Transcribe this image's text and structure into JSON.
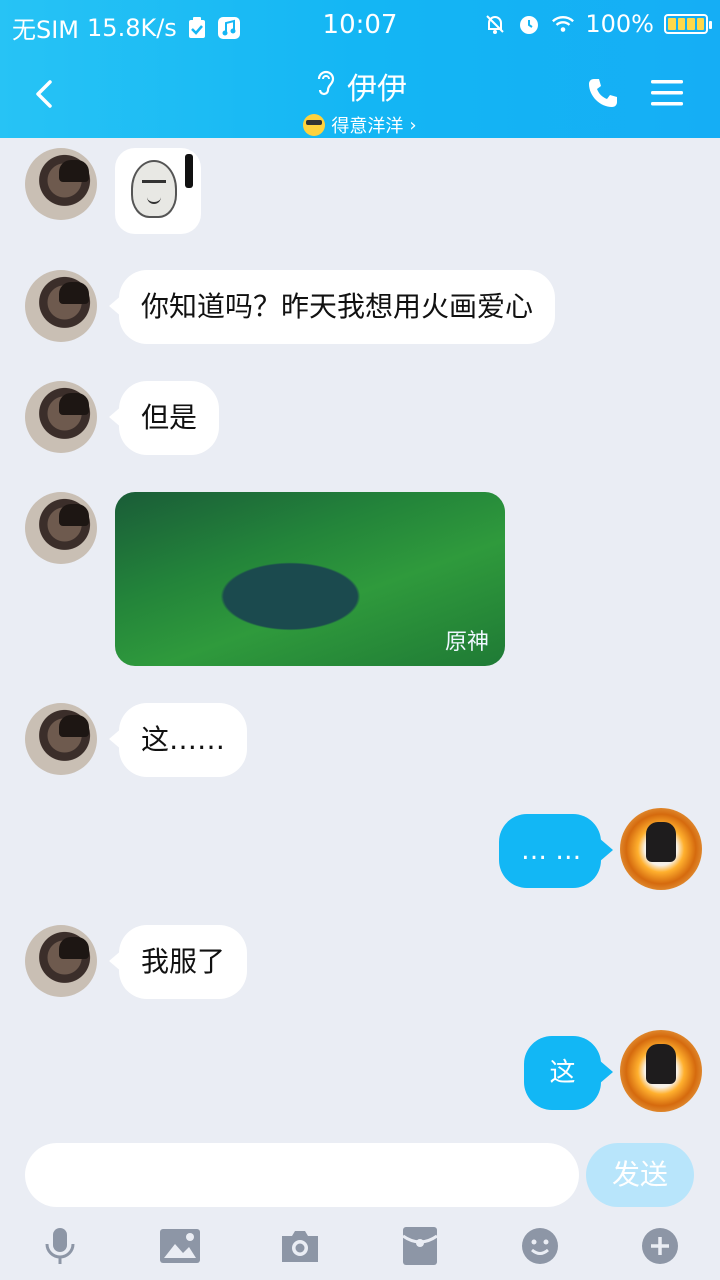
{
  "status_bar": {
    "carrier": "无SIM",
    "speed": "15.8K/s",
    "time": "10:07",
    "battery": "100%"
  },
  "header": {
    "title": "伊伊",
    "subtitle": "得意洋洋",
    "subtitle_chevron": "›"
  },
  "messages": [
    {
      "side": "left",
      "type": "sticker"
    },
    {
      "side": "left",
      "type": "text",
      "text": "你知道吗？昨天我想用火画爱心"
    },
    {
      "side": "left",
      "type": "text",
      "text": "但是"
    },
    {
      "side": "left",
      "type": "image",
      "watermark": "原神"
    },
    {
      "side": "left",
      "type": "text",
      "text": "这……"
    },
    {
      "side": "right",
      "type": "text",
      "text": "… …"
    },
    {
      "side": "left",
      "type": "text",
      "text": "我服了"
    },
    {
      "side": "right",
      "type": "text",
      "text": "这"
    }
  ],
  "input": {
    "value": "",
    "send_label": "发送"
  },
  "toolbar": {
    "icons": [
      "microphone-icon",
      "image-icon",
      "camera-icon",
      "red-packet-icon",
      "emoji-icon",
      "plus-icon"
    ]
  },
  "colors": {
    "header": "#14b6f4",
    "bubble_self": "#12b7f5",
    "background": "#eaedf4",
    "send_disabled": "#b8e5fb"
  }
}
